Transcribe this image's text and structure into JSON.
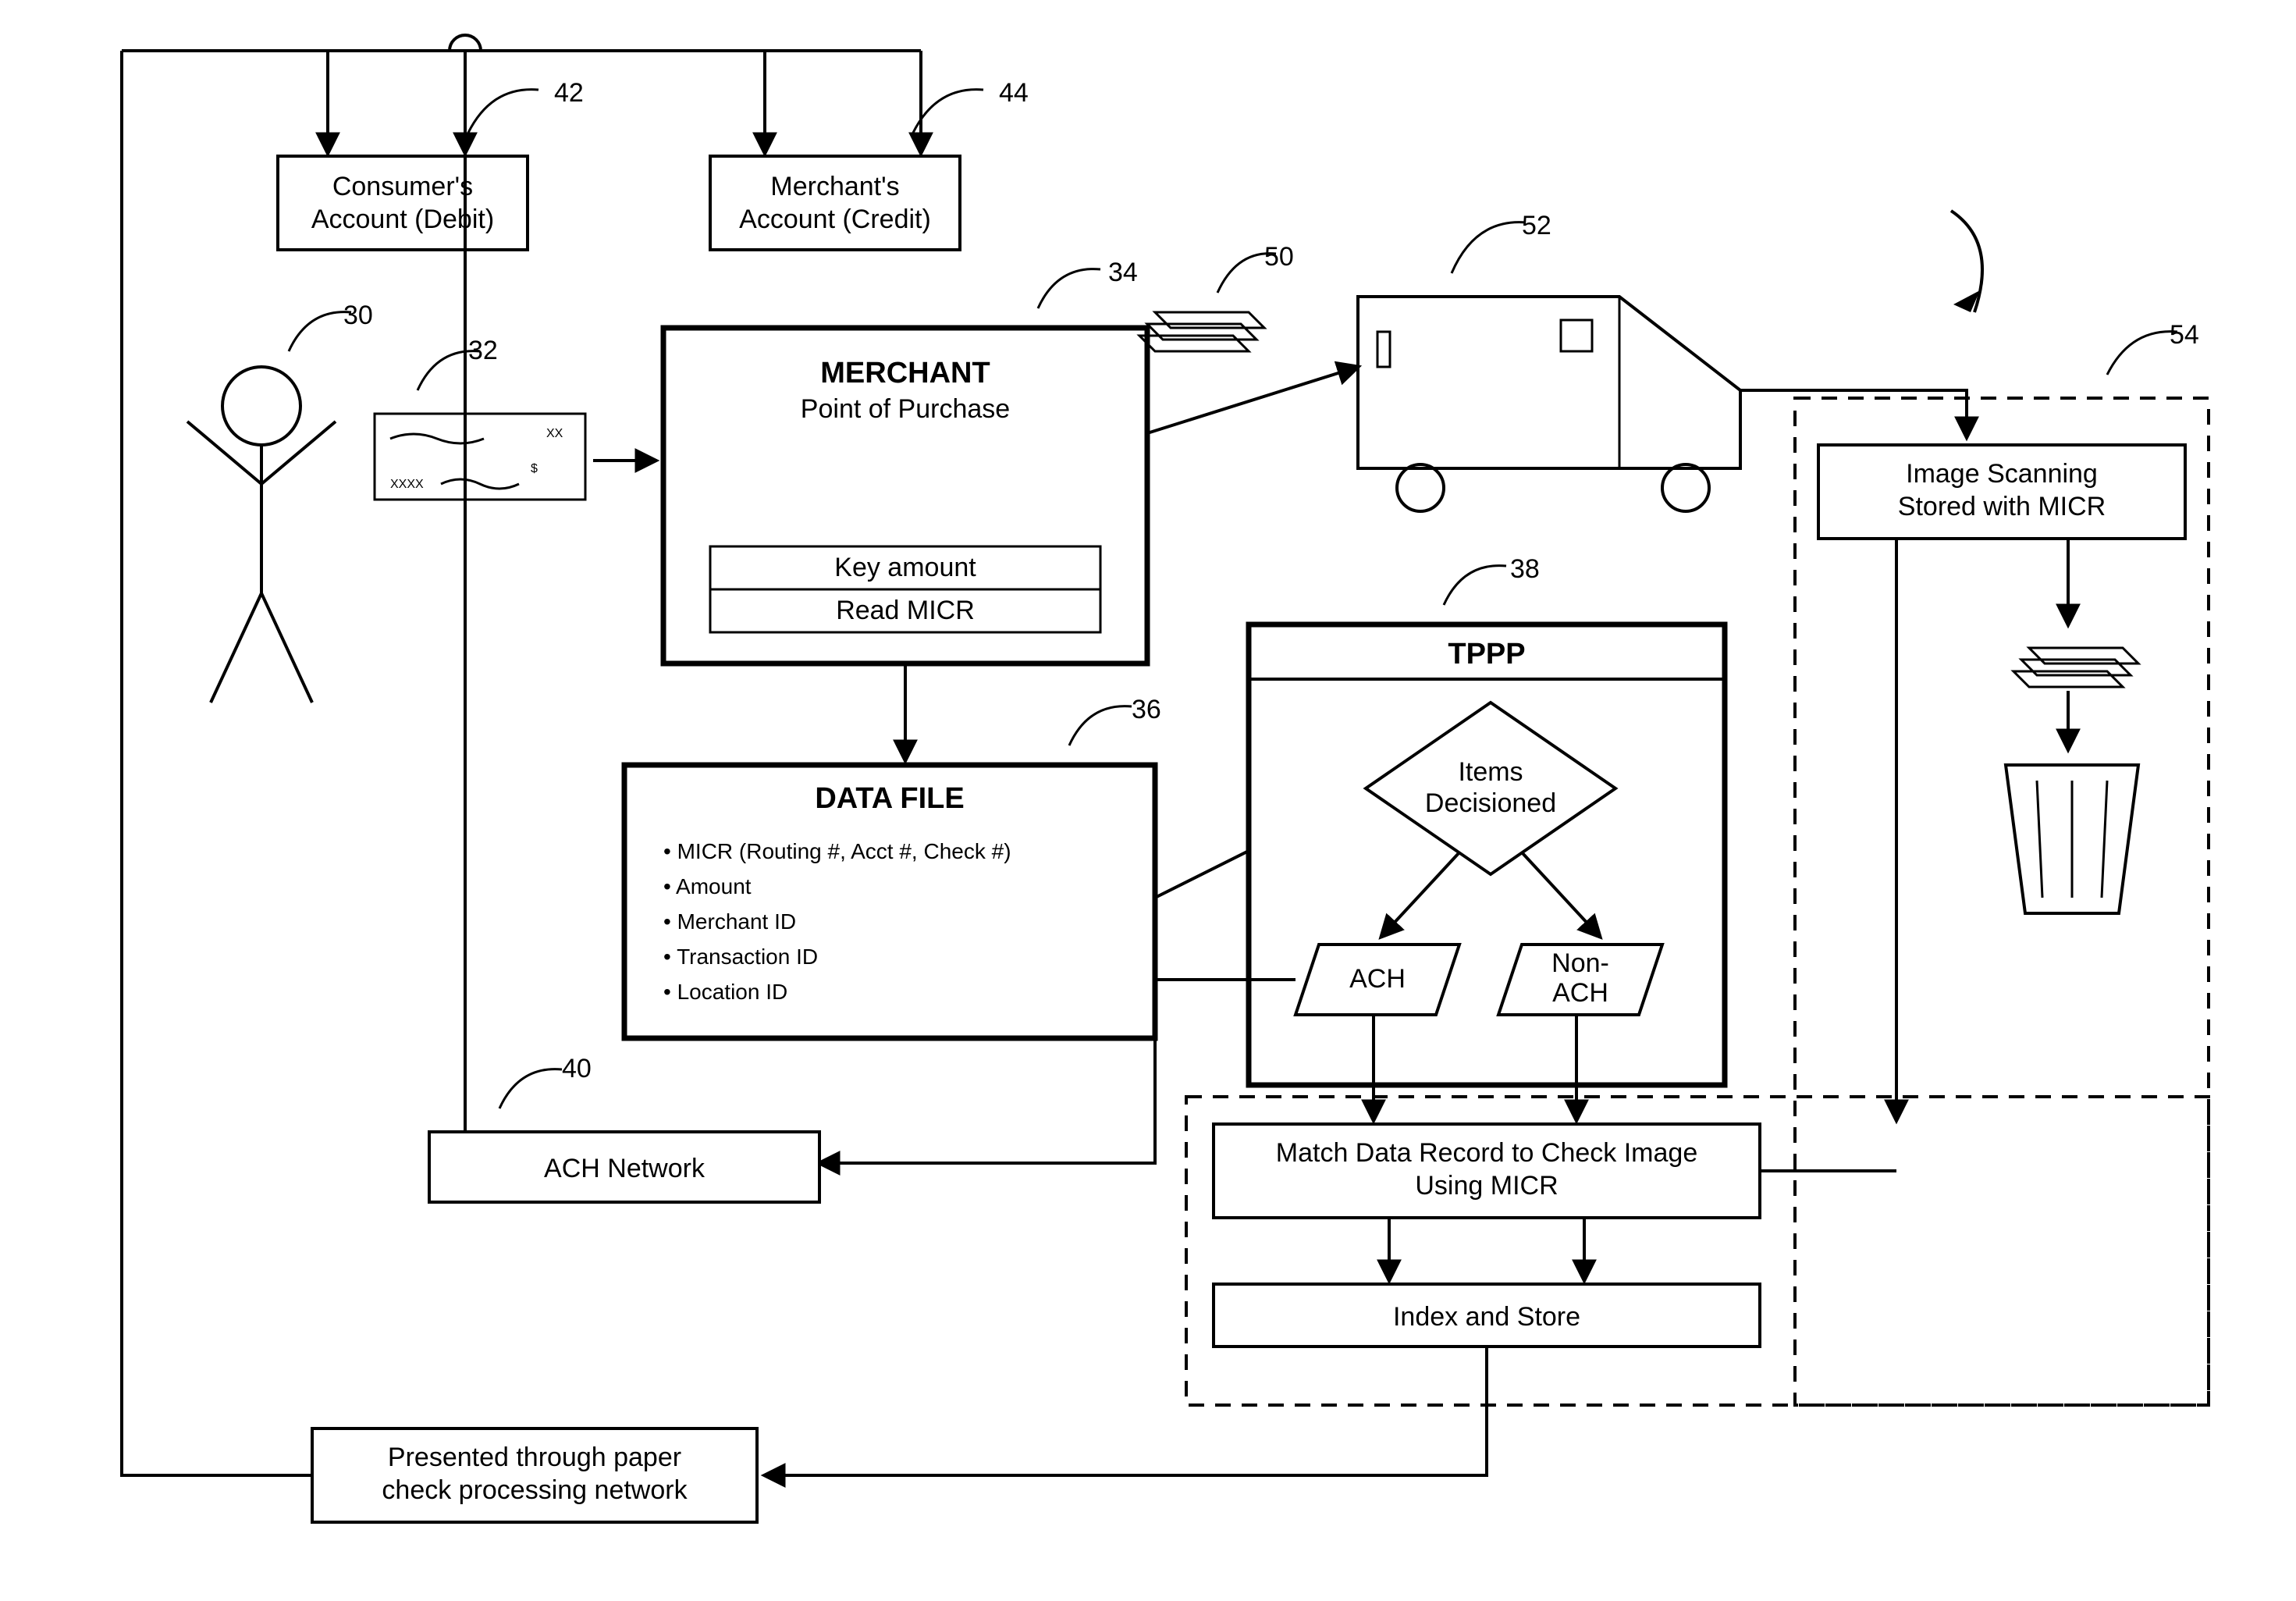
{
  "refs": {
    "r30": "30",
    "r32": "32",
    "r34": "34",
    "r36": "36",
    "r38": "38",
    "r40": "40",
    "r42": "42",
    "r44": "44",
    "r50": "50",
    "r52": "52",
    "r54": "54"
  },
  "consumer": {
    "l1": "Consumer's",
    "l2": "Account (Debit)"
  },
  "merchantAcct": {
    "l1": "Merchant's",
    "l2": "Account (Credit)"
  },
  "check": {
    "xxxx": "XXXX",
    "xx": "XX",
    "dollar": "$"
  },
  "merchant": {
    "title": "MERCHANT",
    "sub": "Point of Purchase",
    "key": "Key amount",
    "read": "Read MICR"
  },
  "datafile": {
    "title": "DATA FILE",
    "b1": "MICR (Routing #, Acct #, Check #)",
    "b2": "Amount",
    "b3": "Merchant ID",
    "b4": "Transaction ID",
    "b5": "Location ID"
  },
  "tppp": {
    "title": "TPPP",
    "dec1": "Items",
    "dec2": "Decisioned",
    "ach": "ACH",
    "non1": "Non-",
    "non2": "ACH"
  },
  "scan": {
    "l1": "Image Scanning",
    "l2": "Stored with MICR"
  },
  "match": {
    "l1": "Match Data Record to Check Image",
    "l2": "Using MICR"
  },
  "index": "Index and Store",
  "achnet": "ACH Network",
  "paper": {
    "l1": "Presented through paper",
    "l2": "check processing network"
  }
}
